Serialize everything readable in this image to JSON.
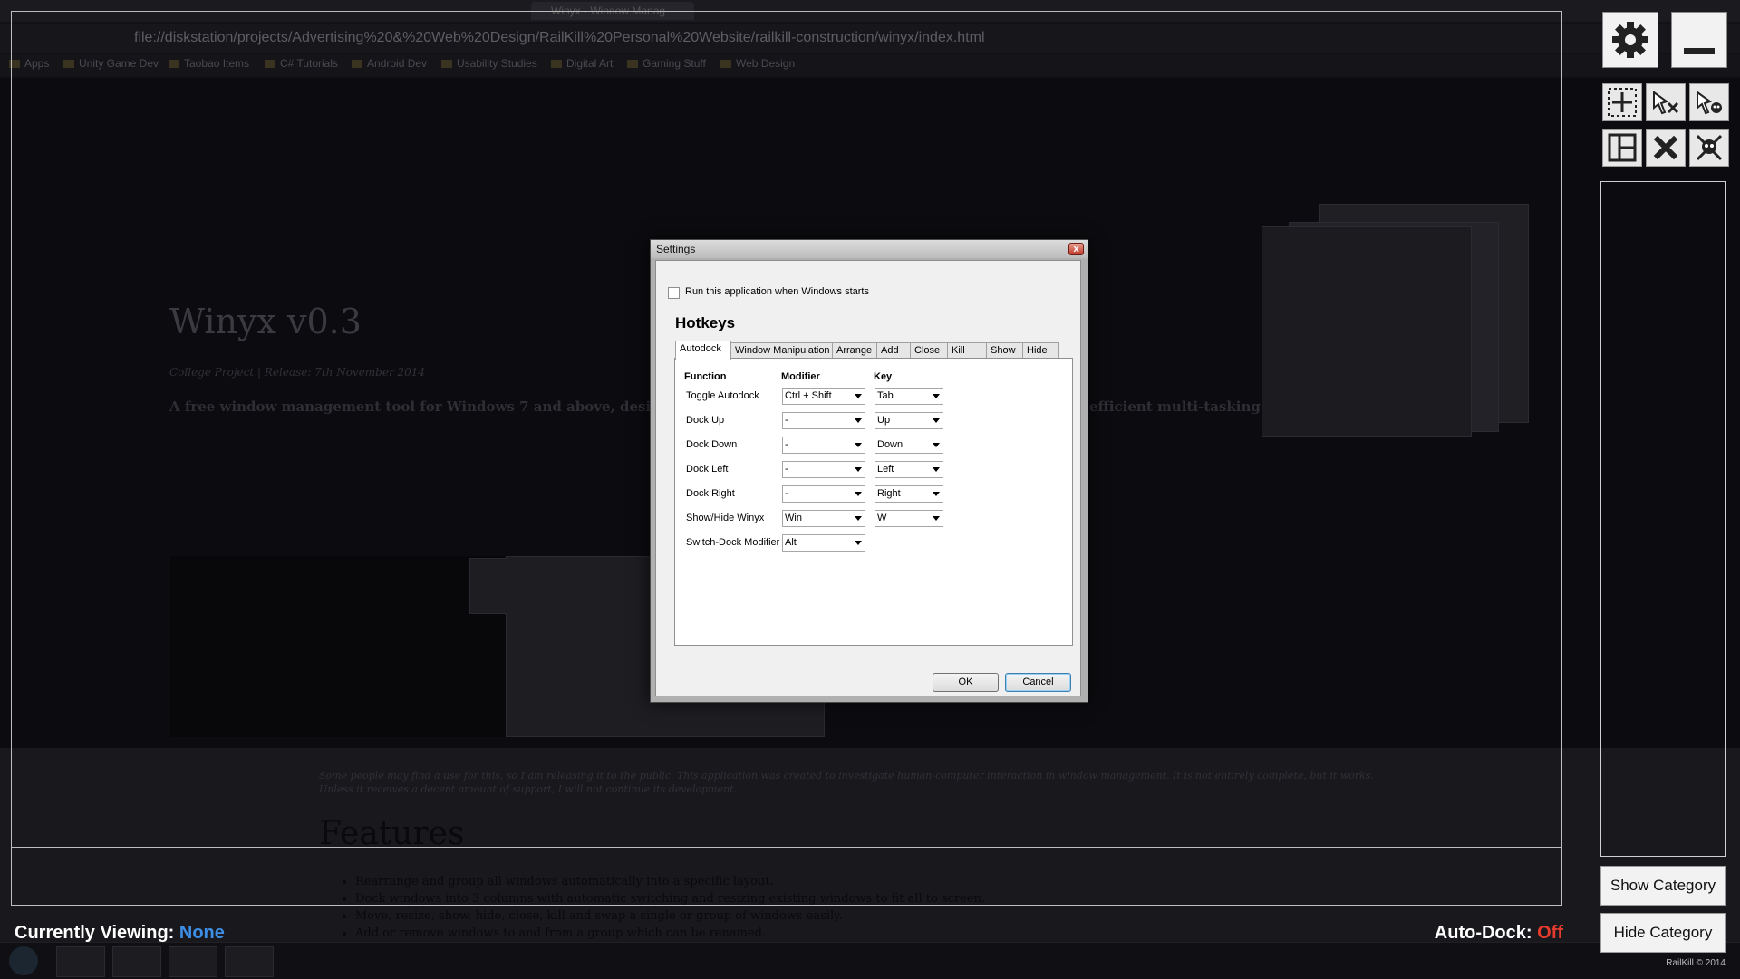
{
  "background": {
    "tabs": [
      "Winyx - Window Manag"
    ],
    "url": "file://diskstation/projects/Advertising%20&%20Web%20Design/RailKill%20Personal%20Website/railkill-construction/winyx/index.html",
    "bookmarks": [
      "Apps",
      "Unity Game Dev",
      "Taobao Items",
      "C# Tutorials",
      "Android Dev",
      "Usability Studies",
      "Digital Art",
      "Gaming Stuff",
      "Web Design"
    ],
    "page_title": "Winyx v0.3",
    "page_subtitle": "College Project | Release: 7th November 2014",
    "page_desc_start": "A free window management tool for Windows 7 and above, designed fo",
    "page_desc_end": "efficient multi-tasking.",
    "page_para": "Some people may find a use for this, so I am releasing it to the public. This application was created to investigate human-computer interaction in window management. It is not entirely complete, but it works. Unless it receives a decent amount of support, I will not continue its development.",
    "features_heading": "Features",
    "features": [
      "Rearrange and group all windows automatically into a specific layout.",
      "Dock windows into 3 columns with automatic switching and resizing existing windows to fit all to screen.",
      "Move, resize, show, hide, close, kill and swap a single or group of windows easily.",
      "Add or remove windows to and from a group which can be renamed."
    ],
    "copyright": "RailKill © 2014"
  },
  "status": {
    "viewing_label": "Currently Viewing:",
    "viewing_value": "None",
    "autodock_label": "Auto-Dock:",
    "autodock_value": "Off"
  },
  "sidebar": {
    "show_category": "Show Category",
    "hide_category": "Hide Category"
  },
  "dialog": {
    "title": "Settings",
    "close_glyph": "x",
    "startup_label": "Run this application when Windows starts",
    "hotkeys_heading": "Hotkeys",
    "tabs": [
      "Autodock",
      "Window Manipulation",
      "Arrange",
      "Add",
      "Close",
      "Kill",
      "Show",
      "Hide"
    ],
    "columns": {
      "function": "Function",
      "modifier": "Modifier",
      "key": "Key"
    },
    "rows": [
      {
        "function": "Toggle Autodock",
        "modifier": "Ctrl + Shift",
        "key": "Tab"
      },
      {
        "function": "Dock Up",
        "modifier": "-",
        "key": "Up"
      },
      {
        "function": "Dock Down",
        "modifier": "-",
        "key": "Down"
      },
      {
        "function": "Dock Left",
        "modifier": "-",
        "key": "Left"
      },
      {
        "function": "Dock Right",
        "modifier": "-",
        "key": "Right"
      },
      {
        "function": "Show/Hide Winyx",
        "modifier": "Win",
        "key": "W"
      },
      {
        "function": "Switch-Dock Modifier",
        "modifier": "Alt",
        "key": ""
      }
    ],
    "ok": "OK",
    "cancel": "Cancel"
  },
  "colors": {
    "viewing_accent": "#3d8ee5",
    "autodock_off": "#e53b2f"
  }
}
